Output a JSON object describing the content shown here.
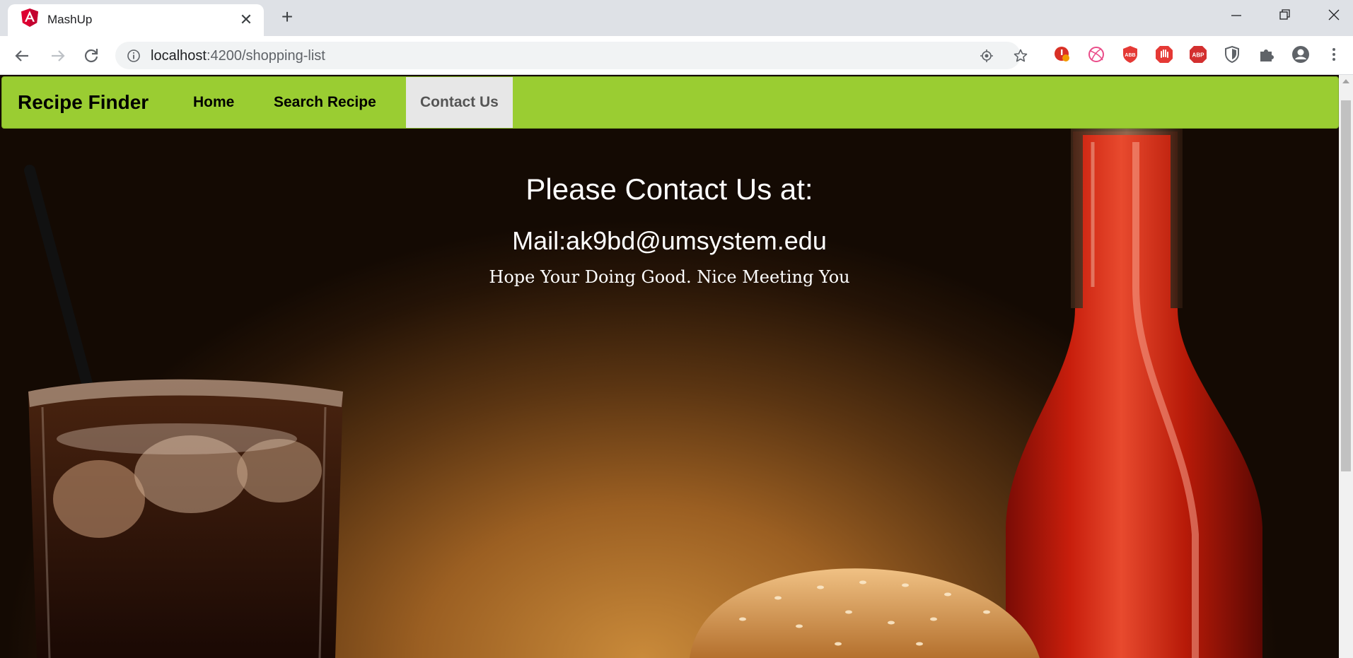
{
  "browser": {
    "tab": {
      "title": "MashUp",
      "close_glyph": "✕",
      "favicon": "angular-icon"
    },
    "new_tab_glyph": "+",
    "url": {
      "host": "localhost",
      "path": ":4200/shopping-list"
    },
    "extensions": [
      "extension-alert-icon",
      "extension-dribbble-icon",
      "adblock-icon",
      "stop-hand-icon",
      "abp-icon",
      "shield-icon",
      "puzzle-icon",
      "profile-icon",
      "more-menu-icon"
    ],
    "accent_color": "#9acd32"
  },
  "navbar": {
    "brand": "Recipe Finder",
    "links": [
      {
        "label": "Home",
        "active": false
      },
      {
        "label": "Search Recipe",
        "active": false
      },
      {
        "label": "Contact Us",
        "active": true
      }
    ]
  },
  "contact": {
    "title": "Please Contact Us at:",
    "mail": "Mail:ak9bd@umsystem.edu",
    "note": "Hope Your Doing Good. Nice Meeting You"
  }
}
